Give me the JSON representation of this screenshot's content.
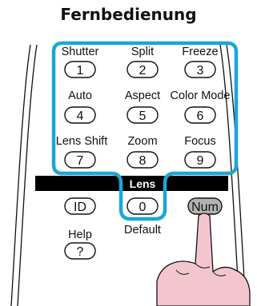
{
  "title": "Fernbedienung",
  "accent_color": "#1aa7d8",
  "rows": [
    {
      "labels": [
        "Shutter",
        "Split",
        "Freeze"
      ],
      "keys": [
        "1",
        "2",
        "3"
      ]
    },
    {
      "labels": [
        "Auto",
        "Aspect",
        "Color Mode"
      ],
      "keys": [
        "4",
        "5",
        "6"
      ]
    },
    {
      "labels": [
        "Lens Shift",
        "Zoom",
        "Focus"
      ],
      "keys": [
        "7",
        "8",
        "9"
      ]
    }
  ],
  "lens_bar": "Lens",
  "bottom": {
    "id_key": "ID",
    "zero_key": "0",
    "num_key": "Num",
    "help_label": "Help",
    "help_key": "?",
    "default_label": "Default"
  },
  "hand_icon": "pointing-finger-icon"
}
